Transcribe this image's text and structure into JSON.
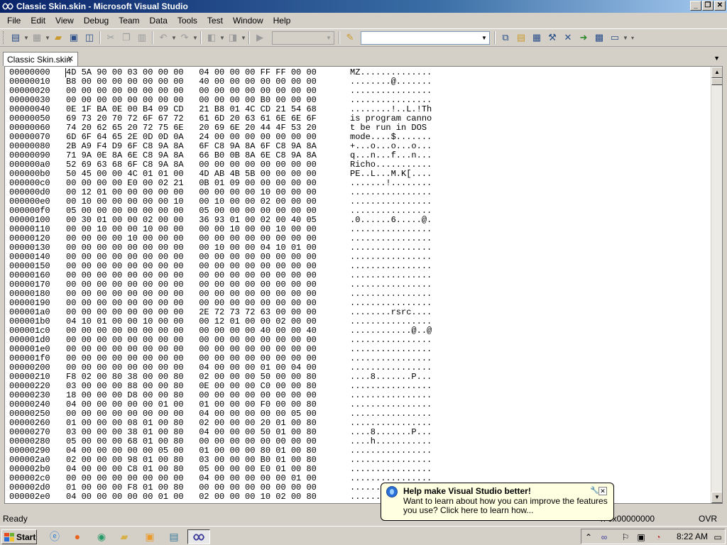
{
  "window": {
    "title": "Classic Skin.skin - Microsoft Visual Studio",
    "controls": {
      "minimize": "_",
      "maximize": "❐",
      "close": "✕"
    }
  },
  "menu": [
    "File",
    "Edit",
    "View",
    "Debug",
    "Team",
    "Data",
    "Tools",
    "Test",
    "Window",
    "Help"
  ],
  "toolbar": {
    "icons": [
      "add-item-icon",
      "add-project-icon",
      "open-icon",
      "save-icon",
      "save-all-icon",
      "cut-icon",
      "copy-icon",
      "paste-icon",
      "undo-icon",
      "redo-icon",
      "navigate-backward-icon",
      "navigate-forward-icon",
      "start-icon",
      "find-in-files-icon",
      "solution-explorer-icon",
      "properties-icon",
      "object-browser-icon",
      "toolbox-icon",
      "start-page-icon"
    ],
    "solution_config_value": "",
    "find_value": ""
  },
  "document_tab": {
    "label": "Classic Skin.skin",
    "close": "✕"
  },
  "hex": {
    "rows": [
      {
        "addr": "00000000",
        "bytes": "4D 5A 90 00 03 00 00 00   04 00 00 00 FF FF 00 00",
        "ascii": "MZ.............."
      },
      {
        "addr": "00000010",
        "bytes": "B8 00 00 00 00 00 00 00   40 00 00 00 00 00 00 00",
        "ascii": "........@......."
      },
      {
        "addr": "00000020",
        "bytes": "00 00 00 00 00 00 00 00   00 00 00 00 00 00 00 00",
        "ascii": "................"
      },
      {
        "addr": "00000030",
        "bytes": "00 00 00 00 00 00 00 00   00 00 00 00 B0 00 00 00",
        "ascii": "................"
      },
      {
        "addr": "00000040",
        "bytes": "0E 1F BA 0E 00 B4 09 CD   21 B8 01 4C CD 21 54 68",
        "ascii": "........!..L.!Th"
      },
      {
        "addr": "00000050",
        "bytes": "69 73 20 70 72 6F 67 72   61 6D 20 63 61 6E 6E 6F",
        "ascii": "is program canno"
      },
      {
        "addr": "00000060",
        "bytes": "74 20 62 65 20 72 75 6E   20 69 6E 20 44 4F 53 20",
        "ascii": "t be run in DOS "
      },
      {
        "addr": "00000070",
        "bytes": "6D 6F 64 65 2E 0D 0D 0A   24 00 00 00 00 00 00 00",
        "ascii": "mode....$......."
      },
      {
        "addr": "00000080",
        "bytes": "2B A9 F4 D9 6F C8 9A 8A   6F C8 9A 8A 6F C8 9A 8A",
        "ascii": "+...o...o...o..."
      },
      {
        "addr": "00000090",
        "bytes": "71 9A 0E 8A 6E C8 9A 8A   66 B0 0B 8A 6E C8 9A 8A",
        "ascii": "q...n...f...n..."
      },
      {
        "addr": "000000a0",
        "bytes": "52 69 63 68 6F C8 9A 8A   00 00 00 00 00 00 00 00",
        "ascii": "Richo..........."
      },
      {
        "addr": "000000b0",
        "bytes": "50 45 00 00 4C 01 01 00   4D AB 4B 5B 00 00 00 00",
        "ascii": "PE..L...M.K[...."
      },
      {
        "addr": "000000c0",
        "bytes": "00 00 00 00 E0 00 02 21   0B 01 09 00 00 00 00 00",
        "ascii": ".......!........"
      },
      {
        "addr": "000000d0",
        "bytes": "00 12 01 00 00 00 00 00   00 00 00 00 10 00 00 00",
        "ascii": "................"
      },
      {
        "addr": "000000e0",
        "bytes": "00 10 00 00 00 00 00 10   00 10 00 00 02 00 00 00",
        "ascii": "................"
      },
      {
        "addr": "000000f0",
        "bytes": "05 00 00 00 00 00 00 00   05 00 00 00 00 00 00 00",
        "ascii": "................"
      },
      {
        "addr": "00000100",
        "bytes": "00 30 01 00 00 02 00 00   36 93 01 00 02 00 40 05",
        "ascii": ".0......6.....@."
      },
      {
        "addr": "00000110",
        "bytes": "00 00 10 00 00 10 00 00   00 00 10 00 00 10 00 00",
        "ascii": "................"
      },
      {
        "addr": "00000120",
        "bytes": "00 00 00 00 10 00 00 00   00 00 00 00 00 00 00 00",
        "ascii": "................"
      },
      {
        "addr": "00000130",
        "bytes": "00 00 00 00 00 00 00 00   00 10 00 00 04 10 01 00",
        "ascii": "................"
      },
      {
        "addr": "00000140",
        "bytes": "00 00 00 00 00 00 00 00   00 00 00 00 00 00 00 00",
        "ascii": "................"
      },
      {
        "addr": "00000150",
        "bytes": "00 00 00 00 00 00 00 00   00 00 00 00 00 00 00 00",
        "ascii": "................"
      },
      {
        "addr": "00000160",
        "bytes": "00 00 00 00 00 00 00 00   00 00 00 00 00 00 00 00",
        "ascii": "................"
      },
      {
        "addr": "00000170",
        "bytes": "00 00 00 00 00 00 00 00   00 00 00 00 00 00 00 00",
        "ascii": "................"
      },
      {
        "addr": "00000180",
        "bytes": "00 00 00 00 00 00 00 00   00 00 00 00 00 00 00 00",
        "ascii": "................"
      },
      {
        "addr": "00000190",
        "bytes": "00 00 00 00 00 00 00 00   00 00 00 00 00 00 00 00",
        "ascii": "................"
      },
      {
        "addr": "000001a0",
        "bytes": "00 00 00 00 00 00 00 00   2E 72 73 72 63 00 00 00",
        "ascii": "........rsrc...."
      },
      {
        "addr": "000001b0",
        "bytes": "04 10 01 00 00 10 00 00   00 12 01 00 00 02 00 00",
        "ascii": "................"
      },
      {
        "addr": "000001c0",
        "bytes": "00 00 00 00 00 00 00 00   00 00 00 00 40 00 00 40",
        "ascii": "............@..@"
      },
      {
        "addr": "000001d0",
        "bytes": "00 00 00 00 00 00 00 00   00 00 00 00 00 00 00 00",
        "ascii": "................"
      },
      {
        "addr": "000001e0",
        "bytes": "00 00 00 00 00 00 00 00   00 00 00 00 00 00 00 00",
        "ascii": "................"
      },
      {
        "addr": "000001f0",
        "bytes": "00 00 00 00 00 00 00 00   00 00 00 00 00 00 00 00",
        "ascii": "................"
      },
      {
        "addr": "00000200",
        "bytes": "00 00 00 00 00 00 00 00   04 00 00 00 01 00 04 00",
        "ascii": "................"
      },
      {
        "addr": "00000210",
        "bytes": "F8 02 00 80 38 00 00 80   02 00 00 00 50 00 00 80",
        "ascii": "....8.......P..."
      },
      {
        "addr": "00000220",
        "bytes": "03 00 00 00 88 00 00 80   0E 00 00 00 C0 00 00 80",
        "ascii": "................"
      },
      {
        "addr": "00000230",
        "bytes": "18 00 00 00 D8 00 00 80   00 00 00 00 00 00 00 00",
        "ascii": "................"
      },
      {
        "addr": "00000240",
        "bytes": "04 00 00 00 00 00 01 00   01 00 00 00 F0 00 00 80",
        "ascii": "................"
      },
      {
        "addr": "00000250",
        "bytes": "00 00 00 00 00 00 00 00   04 00 00 00 00 00 05 00",
        "ascii": "................"
      },
      {
        "addr": "00000260",
        "bytes": "01 00 00 00 08 01 00 80   02 00 00 00 20 01 00 80",
        "ascii": "................"
      },
      {
        "addr": "00000270",
        "bytes": "03 00 00 00 38 01 00 80   04 00 00 00 50 01 00 80",
        "ascii": "....8.......P..."
      },
      {
        "addr": "00000280",
        "bytes": "05 00 00 00 68 01 00 80   00 00 00 00 00 00 00 00",
        "ascii": "....h..........."
      },
      {
        "addr": "00000290",
        "bytes": "04 00 00 00 00 00 05 00   01 00 00 00 80 01 00 80",
        "ascii": "................"
      },
      {
        "addr": "000002a0",
        "bytes": "02 00 00 00 98 01 00 80   03 00 00 00 B0 01 00 80",
        "ascii": "................"
      },
      {
        "addr": "000002b0",
        "bytes": "04 00 00 00 C8 01 00 80   05 00 00 00 E0 01 00 80",
        "ascii": "................"
      },
      {
        "addr": "000002c0",
        "bytes": "00 00 00 00 00 00 00 00   04 00 00 00 00 00 01 00",
        "ascii": "................"
      },
      {
        "addr": "000002d0",
        "bytes": "01 00 00 00 F8 01 00 80   00 00 00 00 00 00 00 00",
        "ascii": "................"
      },
      {
        "addr": "000002e0",
        "bytes": "04 00 00 00 00 00 01 00   02 00 00 00 10 02 00 80",
        "ascii": "................"
      }
    ]
  },
  "statusbar": {
    "status": "Ready",
    "offset": "n 0x00000000",
    "mode": "OVR"
  },
  "balloon": {
    "title": "Help make Visual Studio better!",
    "text": "Want to learn about how you can improve the features you use? Click here to learn how..."
  },
  "taskbar": {
    "start_label": "Start",
    "quick_launch_icons": [
      "ie-icon",
      "firefox-icon",
      "globe-icon",
      "folder-icon",
      "media-icon",
      "remote-desktop-icon"
    ],
    "active_task_icon": "visual-studio-icon",
    "tray_icons": [
      "show-hidden-icon",
      "visual-studio-tray-icon",
      "flag-icon",
      "network-icon",
      "volume-muted-icon",
      "display-icon"
    ],
    "clock": "8:22 AM"
  },
  "colors": {
    "titlebar_start": "#0a246a",
    "titlebar_end": "#a6caf0",
    "balloon_bg": "#ffffe1",
    "chrome": "#d4d0c8"
  }
}
